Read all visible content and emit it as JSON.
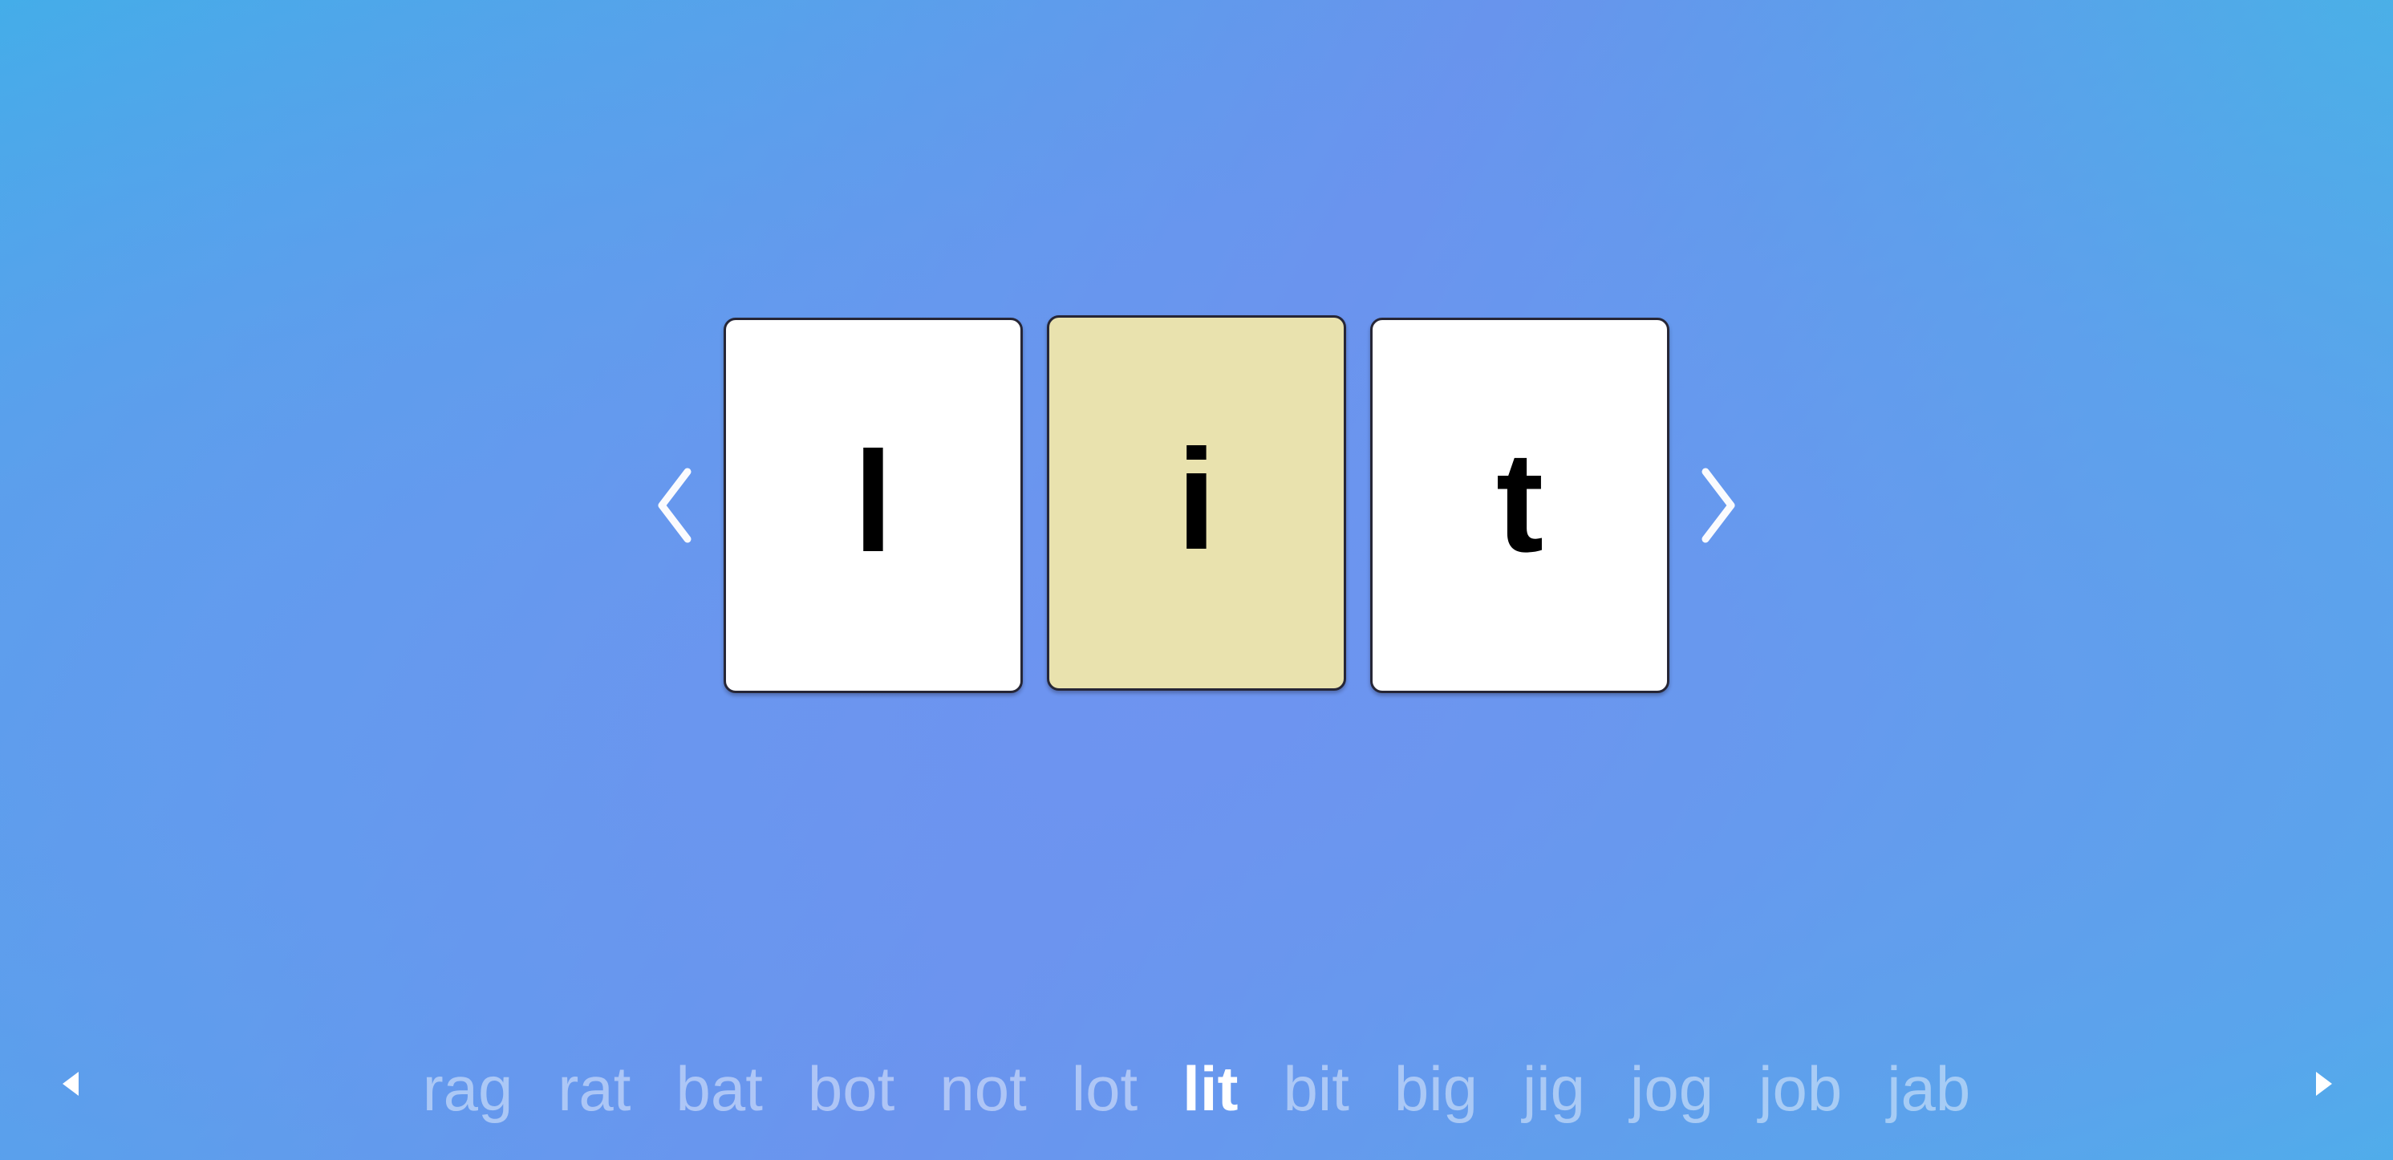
{
  "background": {
    "gradient_start": "#3fb0e8",
    "gradient_mid": "#6694ec",
    "gradient_end": "#3dbce7"
  },
  "stage": {
    "prev_letter_button": {
      "icon": "chevron-left-icon",
      "label": "‹"
    },
    "next_letter_button": {
      "icon": "chevron-right-icon",
      "label": "›"
    },
    "cards": [
      {
        "letter": "l",
        "state": "normal",
        "background": "#ffffff"
      },
      {
        "letter": "i",
        "state": "selected",
        "background": "#e9e2ae"
      },
      {
        "letter": "t",
        "state": "normal",
        "background": "#ffffff"
      }
    ],
    "current_word": "lit"
  },
  "word_strip": {
    "prev_button": {
      "icon": "triangle-left-icon",
      "label": "◀"
    },
    "next_button": {
      "icon": "triangle-right-icon",
      "label": "▶"
    },
    "active_word": "lit",
    "words": [
      {
        "text": "rag",
        "active": false
      },
      {
        "text": "rat",
        "active": false
      },
      {
        "text": "bat",
        "active": false
      },
      {
        "text": "bot",
        "active": false
      },
      {
        "text": "not",
        "active": false
      },
      {
        "text": "lot",
        "active": false
      },
      {
        "text": "lit",
        "active": true
      },
      {
        "text": "bit",
        "active": false
      },
      {
        "text": "big",
        "active": false
      },
      {
        "text": "jig",
        "active": false
      },
      {
        "text": "jog",
        "active": false
      },
      {
        "text": "job",
        "active": false
      },
      {
        "text": "jab",
        "active": false
      }
    ]
  }
}
